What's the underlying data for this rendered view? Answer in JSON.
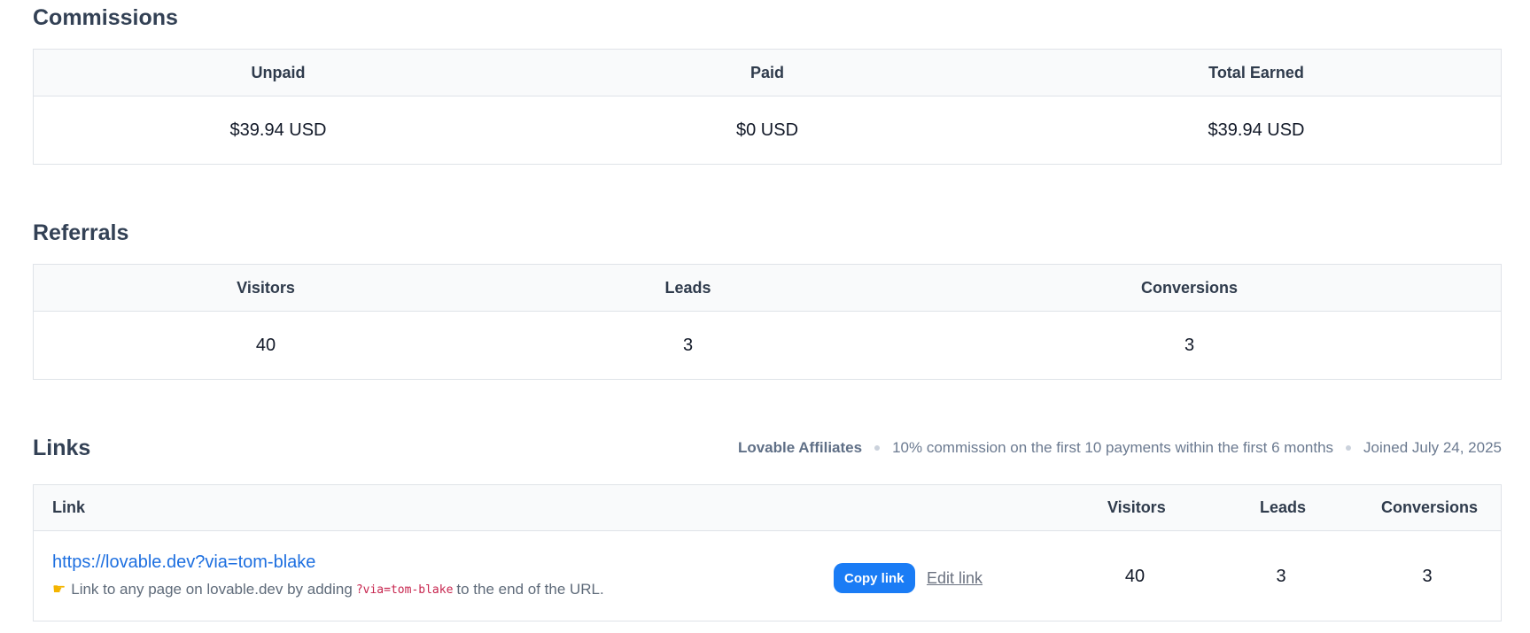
{
  "commissions": {
    "title": "Commissions",
    "headers": [
      "Unpaid",
      "Paid",
      "Total Earned"
    ],
    "values": [
      "$39.94 USD",
      "$0 USD",
      "$39.94 USD"
    ]
  },
  "referrals": {
    "title": "Referrals",
    "headers": [
      "Visitors",
      "Leads",
      "Conversions"
    ],
    "values": [
      "40",
      "3",
      "3"
    ]
  },
  "links": {
    "title": "Links",
    "meta": {
      "program": "Lovable Affiliates",
      "commission": "10% commission on the first 10 payments within the first 6 months",
      "joined": "Joined July 24, 2025"
    },
    "headers": {
      "link": "Link",
      "visitors": "Visitors",
      "leads": "Leads",
      "conversions": "Conversions"
    },
    "row": {
      "url": "https://lovable.dev?via=tom-blake",
      "hint_prefix": "Link to any page on lovable.dev by adding",
      "hint_code": "?via=tom-blake",
      "hint_suffix": "to the end of the URL.",
      "hint_icon": "pointing-hand-icon",
      "copy_label": "Copy link",
      "edit_label": "Edit link",
      "visitors": "40",
      "leads": "3",
      "conversions": "3"
    }
  },
  "colors": {
    "accent": "#1a7cf5",
    "link": "#1d6fe0",
    "heading": "#334155",
    "code": "#c7254e"
  }
}
